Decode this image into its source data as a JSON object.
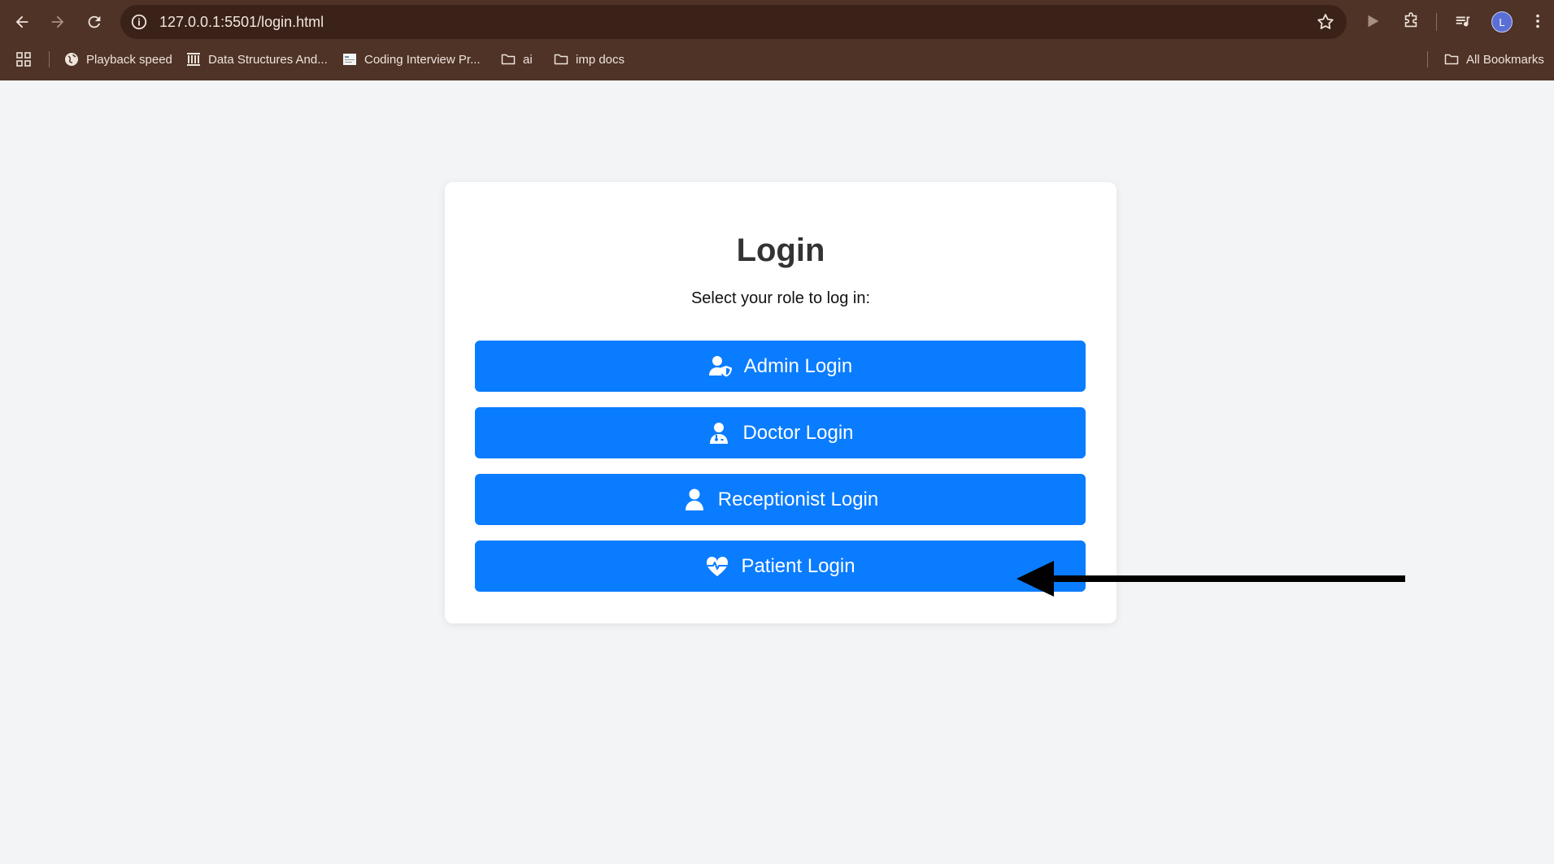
{
  "browser": {
    "url": "127.0.0.1:5501/login.html",
    "avatar_letter": "L",
    "bookmarks": [
      {
        "label": "Playback speed",
        "icon": "globe-icon"
      },
      {
        "label": "Data Structures And...",
        "icon": "building-icon"
      },
      {
        "label": "Coding Interview Pr...",
        "icon": "site-favicon"
      },
      {
        "label": "ai",
        "icon": "folder-icon"
      },
      {
        "label": "imp docs",
        "icon": "folder-icon"
      }
    ],
    "all_bookmarks_label": "All Bookmarks"
  },
  "login": {
    "title": "Login",
    "subtitle": "Select your role to log in:",
    "buttons": [
      {
        "label": "Admin Login",
        "icon": "user-shield-icon"
      },
      {
        "label": "Doctor Login",
        "icon": "user-doctor-icon"
      },
      {
        "label": "Receptionist Login",
        "icon": "user-icon"
      },
      {
        "label": "Patient Login",
        "icon": "heart-pulse-icon"
      }
    ]
  },
  "colors": {
    "button_bg": "#0a7cff",
    "page_bg": "#f2f4f6",
    "chrome_bg": "#4e3326",
    "arrow": "#000000"
  }
}
